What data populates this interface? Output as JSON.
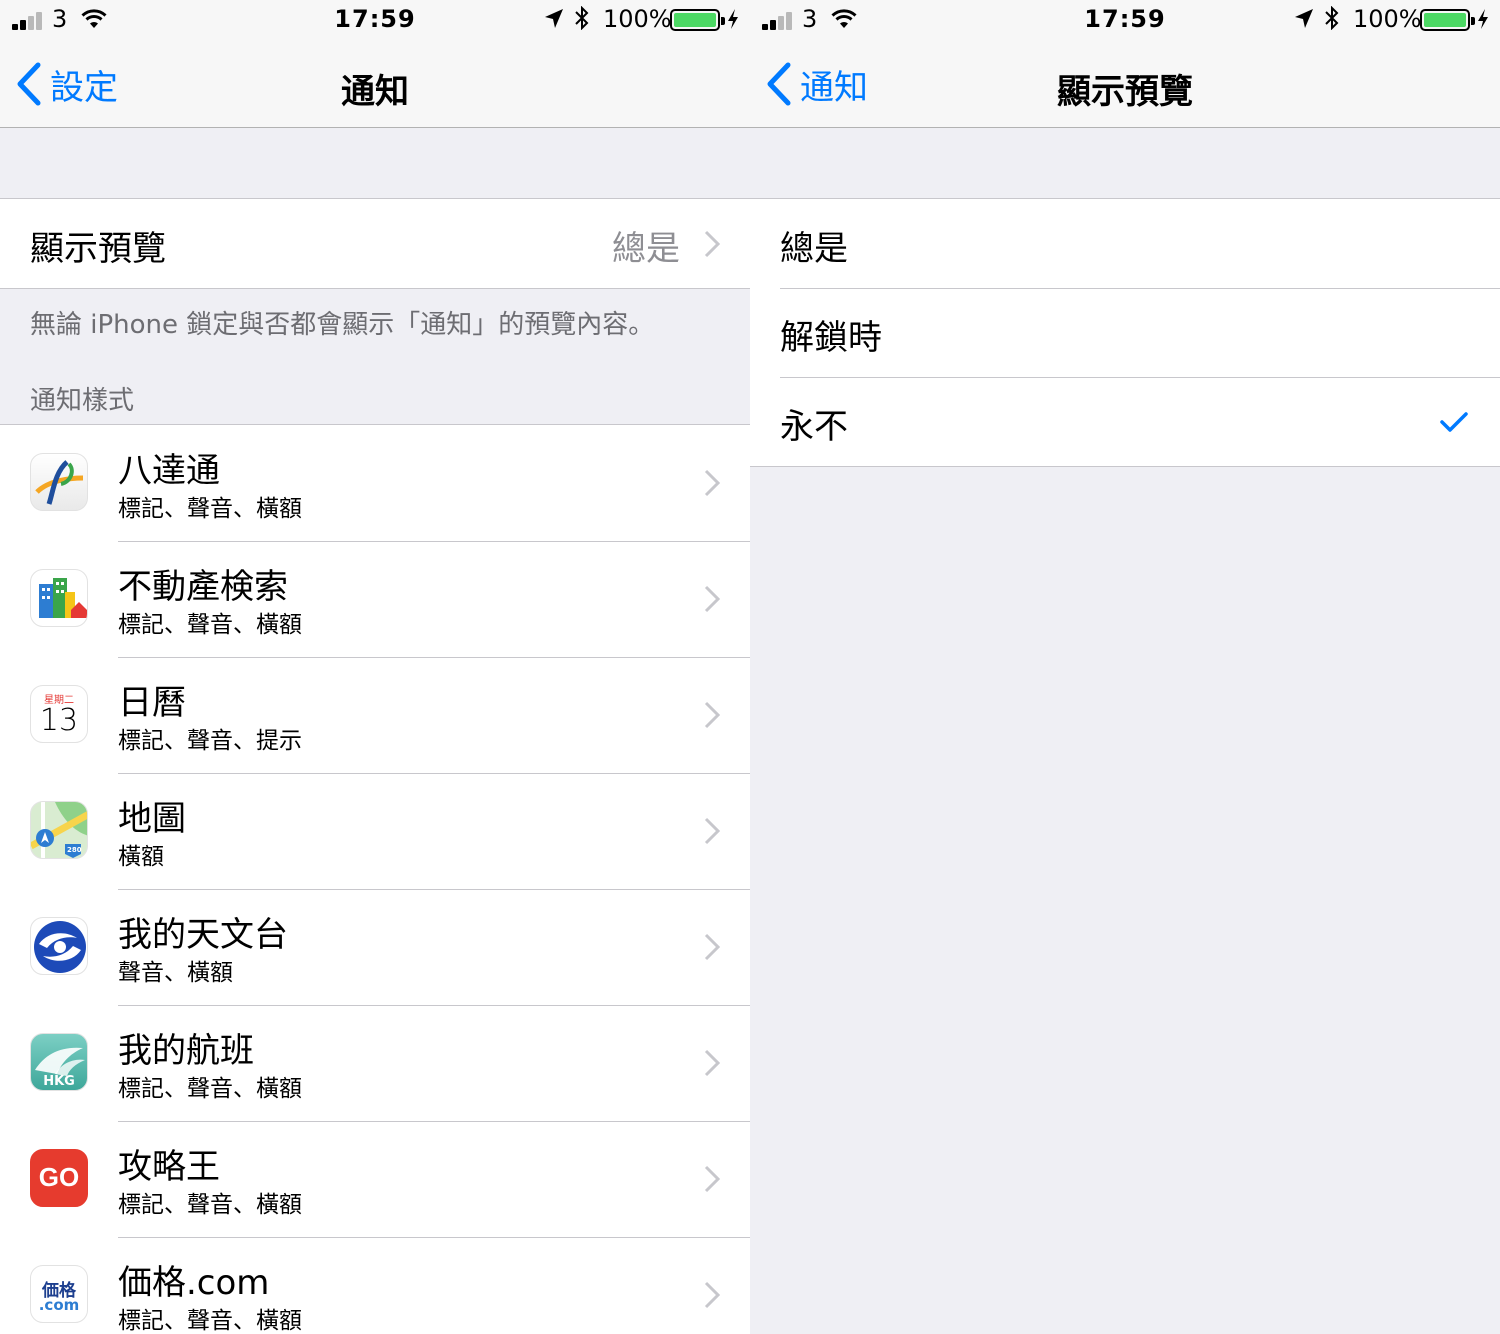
{
  "left": {
    "status": {
      "carrier": "3",
      "time": "17:59",
      "battery": "100%"
    },
    "nav": {
      "back": "設定",
      "title": "通知"
    },
    "preview_row": {
      "label": "顯示預覽",
      "value": "總是"
    },
    "preview_footnote": "無論 iPhone 鎖定與否都會顯示「通知」的預覽內容。",
    "section_header": "通知樣式",
    "apps": [
      {
        "name": "八達通",
        "detail": "標記、聲音、橫額",
        "icon": "octopus-icon"
      },
      {
        "name": "不動產検索",
        "detail": "標記、聲音、橫額",
        "icon": "real-estate-icon"
      },
      {
        "name": "日曆",
        "detail": "標記、聲音、提示",
        "icon": "calendar-icon",
        "icon_text": {
          "day": "星期二",
          "date": "13"
        }
      },
      {
        "name": "地圖",
        "detail": "橫額",
        "icon": "maps-icon",
        "icon_text": {
          "route": "280"
        }
      },
      {
        "name": "我的天文台",
        "detail": "聲音、橫額",
        "icon": "observatory-icon"
      },
      {
        "name": "我的航班",
        "detail": "標記、聲音、橫額",
        "icon": "flight-icon",
        "icon_text": {
          "code": "HKG"
        }
      },
      {
        "name": "攻略王",
        "detail": "標記、聲音、橫額",
        "icon": "go-guide-icon",
        "icon_text": {
          "logo": "GO"
        }
      },
      {
        "name": "価格.com",
        "detail": "標記、聲音、橫額",
        "icon": "kakaku-icon",
        "icon_text": {
          "top": "価格",
          "bottom": ".com"
        }
      }
    ]
  },
  "right": {
    "status": {
      "carrier": "3",
      "time": "17:59",
      "battery": "100%"
    },
    "nav": {
      "back": "通知",
      "title": "顯示預覽"
    },
    "options": [
      {
        "label": "總是",
        "selected": false
      },
      {
        "label": "解鎖時",
        "selected": false
      },
      {
        "label": "永不",
        "selected": true
      }
    ]
  },
  "colors": {
    "accent": "#007aff",
    "battery": "#4cd964",
    "background": "#efeff4"
  }
}
